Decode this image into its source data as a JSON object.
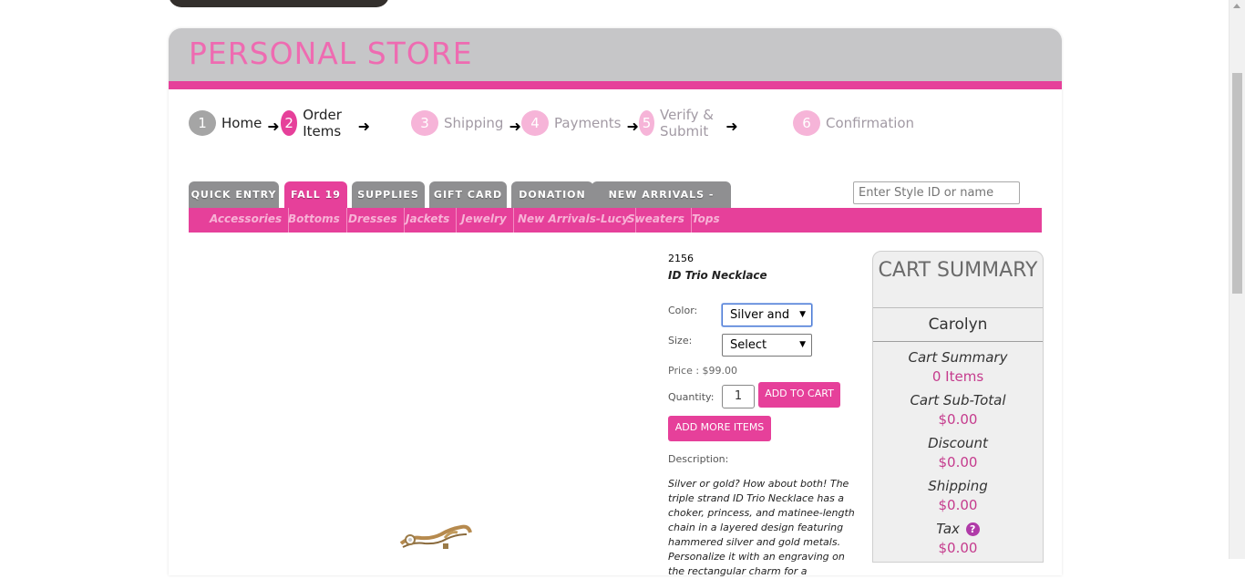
{
  "store": {
    "title": "PERSONAL STORE"
  },
  "steps": [
    {
      "num": "1",
      "label": "Home"
    },
    {
      "num": "2",
      "label": "Order Items"
    },
    {
      "num": "3",
      "label": "Shipping"
    },
    {
      "num": "4",
      "label": "Payments"
    },
    {
      "num": "5",
      "label": "Verify & Submit"
    },
    {
      "num": "6",
      "label": "Confirmation"
    }
  ],
  "tabs": [
    "QUICK ENTRY",
    "FALL 19",
    "SUPPLIES",
    "GIFT CARD",
    "DONATION",
    "NEW ARRIVALS - JOAN"
  ],
  "subnav": [
    "Accessories",
    "Bottoms",
    "Dresses",
    "Jackets",
    "Jewelry",
    "New Arrivals-Lucy",
    "Sweaters",
    "Tops"
  ],
  "search": {
    "placeholder": "Enter Style ID or name"
  },
  "product": {
    "sku": "2156",
    "name": "ID Trio Necklace",
    "color_label": "Color:",
    "color_value": "Silver and",
    "size_label": "Size:",
    "size_value": "Select",
    "price": "Price : $99.00",
    "quantity_label": "Quantity:",
    "quantity_value": "1",
    "add_to_cart": "ADD TO CART",
    "add_more": "ADD MORE ITEMS",
    "description_label": "Description:",
    "description": "Silver or gold? How about both! The triple strand ID Trio Necklace has a choker, princess, and matinee-length chain in a layered design featuring hammered silver and gold metals. Personalize it with an engraving on the rectangular charm for a"
  },
  "cart": {
    "title": "CART SUMMARY",
    "customer": "Carolyn",
    "rows": [
      {
        "label": "Cart Summary",
        "value": "0 Items"
      },
      {
        "label": "Cart Sub-Total",
        "value": "$0.00"
      },
      {
        "label": "Discount",
        "value": "$0.00"
      },
      {
        "label": "Shipping",
        "value": "$0.00"
      },
      {
        "label": "Tax",
        "value": "$0.00"
      }
    ],
    "tax_help": "?"
  },
  "colors": {
    "accent": "#e6409a",
    "header_gray": "#c6c6c8",
    "title_pink": "#ee6bb1"
  },
  "icons": [
    "arrow-right-icon",
    "help-icon",
    "caret-down-icon"
  ]
}
